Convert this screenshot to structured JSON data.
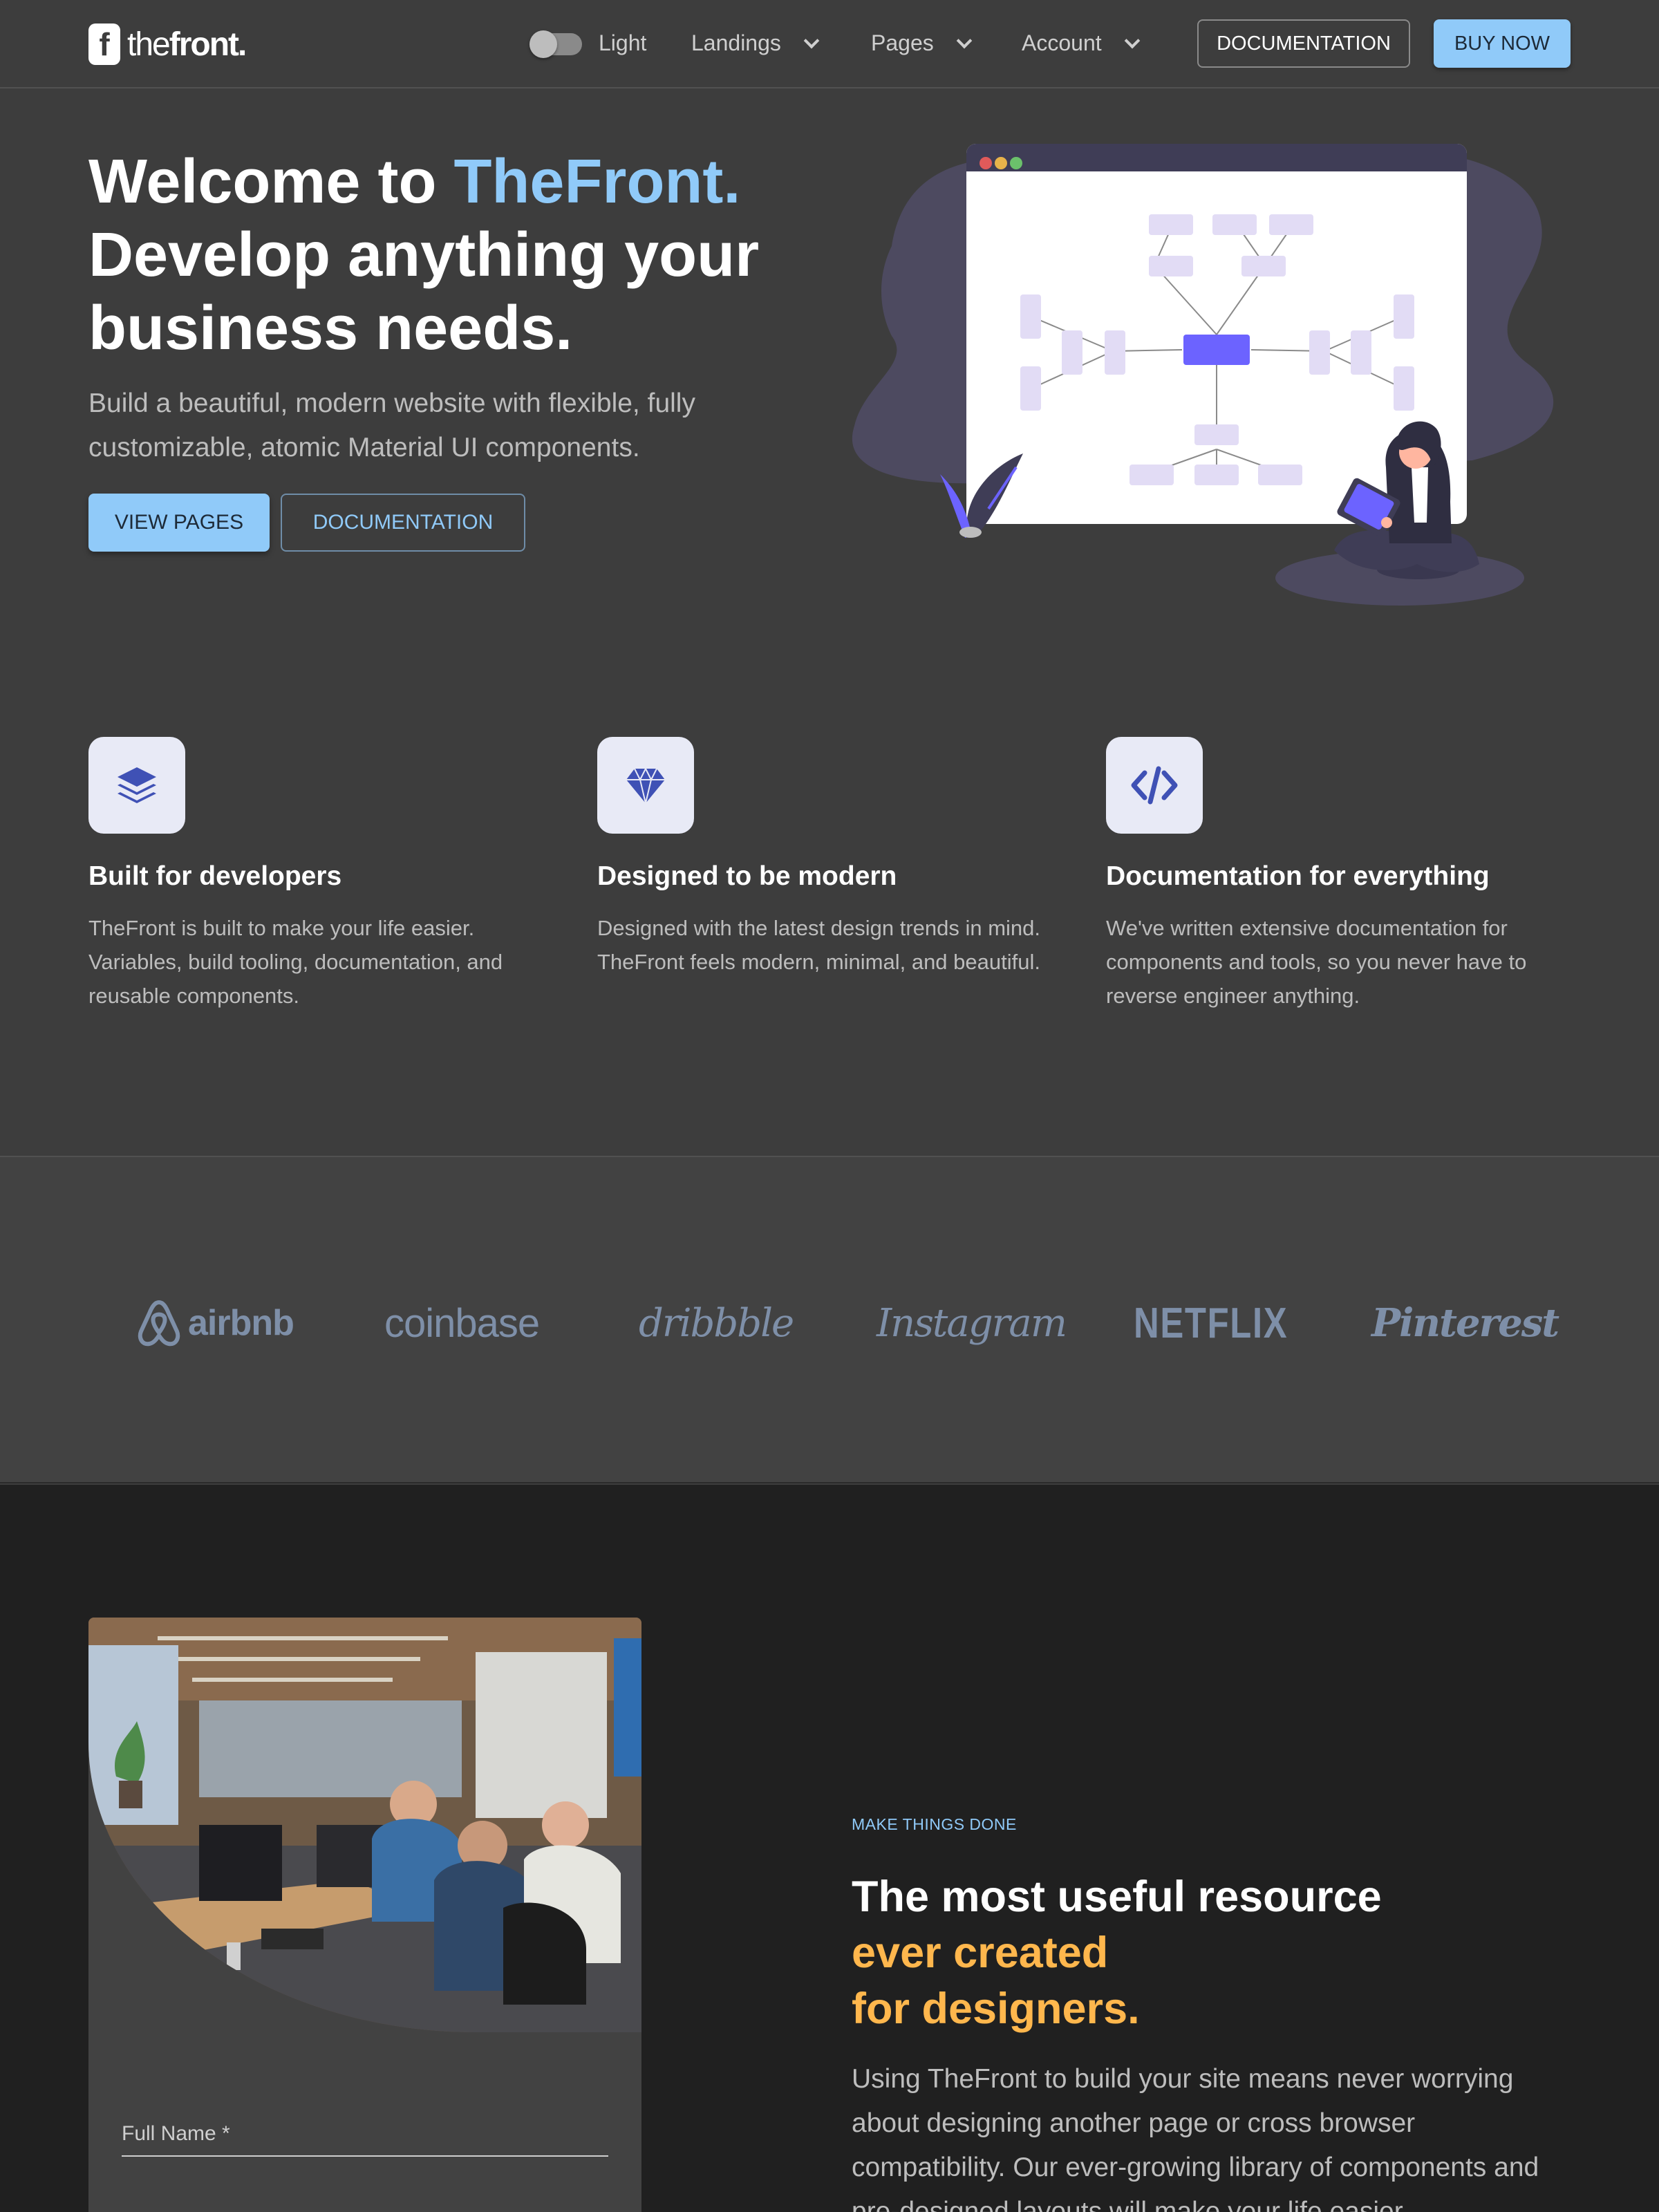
{
  "header": {
    "logo_text_light": "the",
    "logo_text_bold": "front.",
    "logo_mark": "f",
    "theme_toggle_label": "Light",
    "nav": [
      {
        "label": "Landings"
      },
      {
        "label": "Pages"
      },
      {
        "label": "Account"
      }
    ],
    "documentation_label": "DOCUMENTATION",
    "buy_label": "BUY NOW"
  },
  "hero": {
    "title_prefix": "Welcome to ",
    "title_accent": "TheFront.",
    "title_rest": "Develop anything your business needs.",
    "subtitle": "Build a beautiful, modern website with flexible, fully customizable, atomic Material UI components.",
    "primary_button": "VIEW PAGES",
    "secondary_button": "DOCUMENTATION"
  },
  "features": [
    {
      "icon": "layers-icon",
      "title": "Built for developers",
      "description": "TheFront is built to make your life easier. Variables, build tooling, documentation, and reusable components."
    },
    {
      "icon": "diamond-icon",
      "title": "Designed to be modern",
      "description": "Designed with the latest design trends in mind. TheFront feels modern, minimal, and beautiful."
    },
    {
      "icon": "code-icon",
      "title": "Documentation for everything",
      "description": "We've written extensive documentation for components and tools, so you never have to reverse engineer anything."
    }
  ],
  "partners": [
    "airbnb",
    "coinbase",
    "dribbble",
    "Instagram",
    "NETFLIX",
    "Pinterest"
  ],
  "resource": {
    "form_field_label": "Full Name *",
    "eyebrow": "MAKE THINGS DONE",
    "title_line1": "The most useful resource",
    "title_line2": "ever created",
    "title_line3": "for designers.",
    "description": "Using TheFront to build your site means never worrying about designing another page or cross browser compatibility. Our ever-growing library of components and pre-designed layouts will make your life easier."
  },
  "colors": {
    "accent_blue": "#90caf9",
    "accent_yellow": "#ffb74d",
    "background": "#3d3d3d",
    "background_dark": "#202020",
    "icon_indigo": "#3f51b5"
  }
}
